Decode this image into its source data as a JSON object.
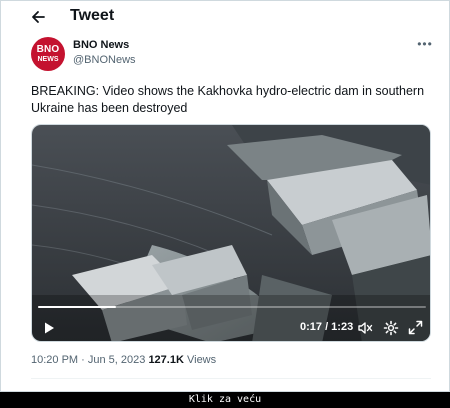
{
  "header": {
    "title": "Tweet"
  },
  "author": {
    "avatar_top": "BNO",
    "avatar_bottom": "NEWS",
    "name": "BNO News",
    "handle": "@BNONews",
    "brand_color": "#c4122f"
  },
  "tweet": {
    "text": "BREAKING: Video shows the Kakhovka hydro-electric dam in southern Ukraine has been destroyed"
  },
  "video": {
    "time": "0:17 / 1:23",
    "progress": 0.2,
    "icons": [
      "play-icon",
      "mute-icon",
      "settings-icon",
      "fullscreen-icon"
    ]
  },
  "meta": {
    "time": "10:20 PM",
    "separator": " · ",
    "date": "Jun 5, 2023",
    "views_count": "127.1K",
    "views_label": "Views"
  },
  "caption": {
    "text": "Klik za veću"
  }
}
